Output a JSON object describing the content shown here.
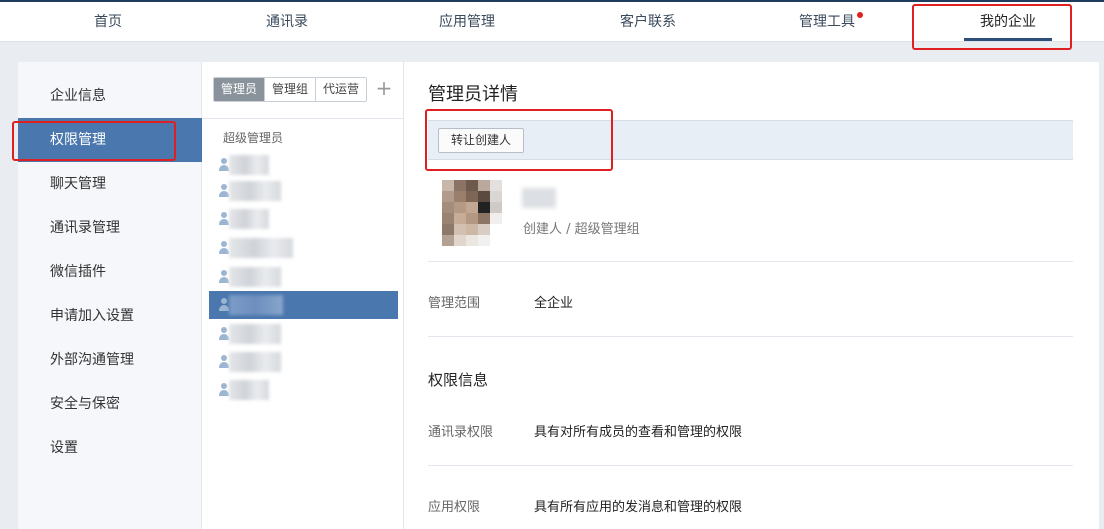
{
  "topnav": {
    "items": [
      "首页",
      "通讯录",
      "应用管理",
      "客户联系",
      "管理工具",
      "我的企业"
    ],
    "active": "我的企业"
  },
  "sidebar": {
    "items": [
      "企业信息",
      "权限管理",
      "聊天管理",
      "通讯录管理",
      "微信插件",
      "申请加入设置",
      "外部沟通管理",
      "安全与保密",
      "设置"
    ],
    "active": "权限管理"
  },
  "admin_list": {
    "tabs": [
      "管理员",
      "管理组",
      "代运营"
    ],
    "active_tab": "管理员",
    "add_icon": "plus-icon",
    "group_label": "超级管理员",
    "selected_index": 5
  },
  "detail": {
    "title": "管理员详情",
    "transfer_button": "转让创建人",
    "role": "创建人 / 超级管理组",
    "scope_label": "管理范围",
    "scope_value": "全企业",
    "section_title": "权限信息",
    "contacts_perm_label": "通讯录权限",
    "contacts_perm_value": "具有对所有成员的查看和管理的权限",
    "apps_perm_label": "应用权限",
    "apps_perm_value": "具有所有应用的发消息和管理的权限"
  },
  "colors": {
    "accent": "#4a77ad",
    "highlight": "#e02020",
    "notify_dot": "#e0201f"
  }
}
